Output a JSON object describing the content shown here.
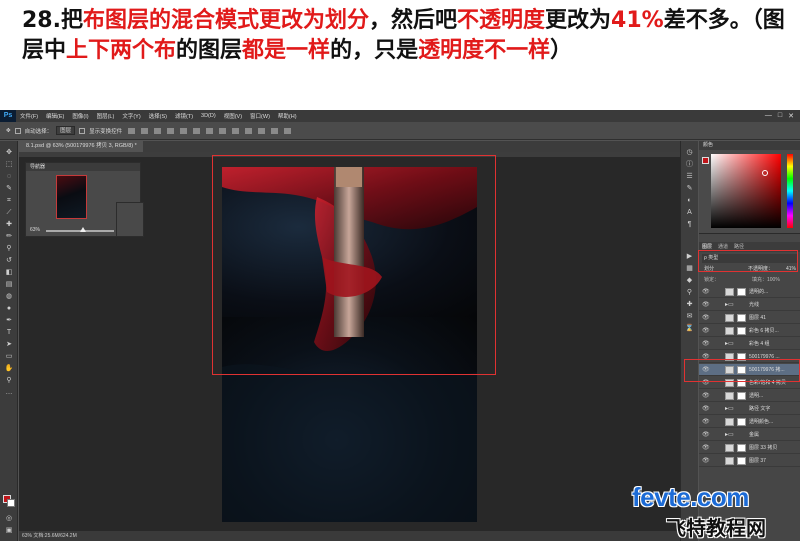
{
  "caption": {
    "parts": [
      {
        "text": "28.把",
        "red": false
      },
      {
        "text": "布图层的混合模式更改为划分",
        "red": true
      },
      {
        "text": "，然后吧",
        "red": false
      },
      {
        "text": "不透明度",
        "red": true
      },
      {
        "text": "更改为",
        "red": false
      },
      {
        "text": "41%",
        "red": true
      },
      {
        "text": "差不多。（图层中",
        "red": false
      },
      {
        "text": "上下两个布",
        "red": true
      },
      {
        "text": "的图层",
        "red": false
      },
      {
        "text": "都是一样",
        "red": true
      },
      {
        "text": "的，只是",
        "red": false
      },
      {
        "text": "透明度不一样",
        "red": true
      },
      {
        "text": "）",
        "red": false
      }
    ]
  },
  "menubar": {
    "app_logo": "Ps",
    "items": [
      "文件(F)",
      "编辑(E)",
      "图像(I)",
      "图层(L)",
      "文字(Y)",
      "选择(S)",
      "滤镜(T)",
      "3D(D)",
      "视图(V)",
      "窗口(W)",
      "帮助(H)"
    ],
    "window_buttons": [
      "—",
      "□",
      "✕"
    ]
  },
  "options_bar": {
    "auto_select_label": "自动选择：",
    "auto_select_value": "图层",
    "show_transform_label": "显示变换控件"
  },
  "document_tab": {
    "title": "8.1.psd @ 63% (500179976 拷贝 3, RGB/8) *"
  },
  "navigator": {
    "title": "导航器",
    "zoom": "63%"
  },
  "color_panel": {
    "tabs": "颜色",
    "fg_color": "#c0151a"
  },
  "layers_panel": {
    "tabs": [
      "图层",
      "通道",
      "路径"
    ],
    "filter_label": "ρ 类型",
    "blend_mode": "划分",
    "opacity_label": "不透明度：",
    "opacity_value": "41%",
    "lock_label": "锁定：",
    "fill_label": "填充：100%",
    "layers": [
      {
        "name": "透明的...",
        "kind": "layer",
        "selected": false
      },
      {
        "name": "光线",
        "kind": "folder",
        "selected": false
      },
      {
        "name": "图层 41",
        "kind": "layer",
        "selected": false
      },
      {
        "name": "彩色 6 拷贝...",
        "kind": "layer",
        "selected": false
      },
      {
        "name": "彩色 4 组",
        "kind": "folder",
        "selected": false
      },
      {
        "name": "500179976 ...",
        "kind": "layer",
        "selected": false
      },
      {
        "name": "500179976 拷...",
        "kind": "layer",
        "selected": true
      },
      {
        "name": "色彩/饱和 4 拷贝",
        "kind": "layer",
        "selected": false
      },
      {
        "name": "透明...",
        "kind": "layer",
        "selected": false
      },
      {
        "name": "路径 文字",
        "kind": "folder",
        "selected": false
      },
      {
        "name": "透明颜色...",
        "kind": "layer",
        "selected": false
      },
      {
        "name": "金属",
        "kind": "folder",
        "selected": false
      },
      {
        "name": "图层 33 拷贝",
        "kind": "layer",
        "selected": false
      },
      {
        "name": "图层 37",
        "kind": "layer",
        "selected": false
      }
    ]
  },
  "status_bar": {
    "text": "63%    文档:25.6M/624.2M"
  },
  "watermark": {
    "line1": "fevte.com",
    "line2": "飞特教程网"
  }
}
